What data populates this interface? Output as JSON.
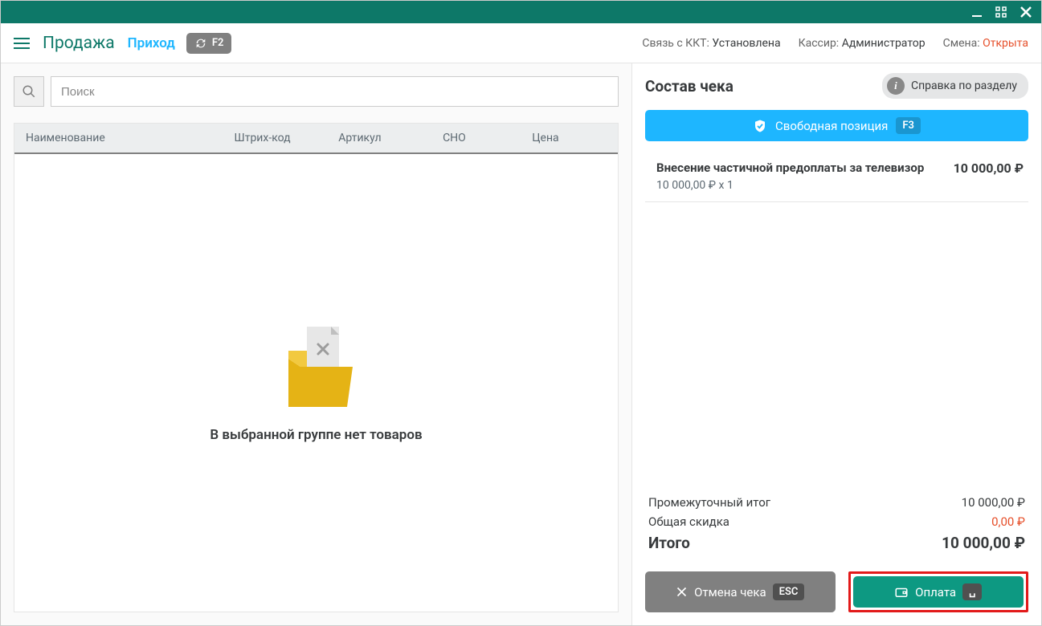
{
  "titlebar": {},
  "header": {
    "sale": "Продажа",
    "income": "Приход",
    "f2": "F2",
    "kkt_label": "Связь с ККТ:",
    "kkt_value": "Установлена",
    "cashier_label": "Кассир:",
    "cashier_value": "Администратор",
    "shift_label": "Смена:",
    "shift_value": "Открыта"
  },
  "search": {
    "placeholder": "Поиск"
  },
  "columns": {
    "name": "Наименование",
    "barcode": "Штрих-код",
    "article": "Артикул",
    "sno": "СНО",
    "price": "Цена"
  },
  "empty": "В выбранной группе нет товаров",
  "receipt": {
    "title": "Состав чека",
    "help": "Справка по разделу",
    "free_pos": "Свободная позиция",
    "free_pos_key": "F3",
    "item": {
      "name": "Внесение частичной предоплаты за телевизор",
      "detail": "10 000,00 ₽ х 1",
      "total": "10 000,00 ₽"
    },
    "subtotal_label": "Промежуточный итог",
    "subtotal_value": "10 000,00 ₽",
    "discount_label": "Общая скидка",
    "discount_value": "0,00 ₽",
    "grand_label": "Итого",
    "grand_value": "10 000,00 ₽",
    "cancel": "Отмена чека",
    "cancel_key": "ESC",
    "pay": "Оплата",
    "pay_key": "␣"
  }
}
